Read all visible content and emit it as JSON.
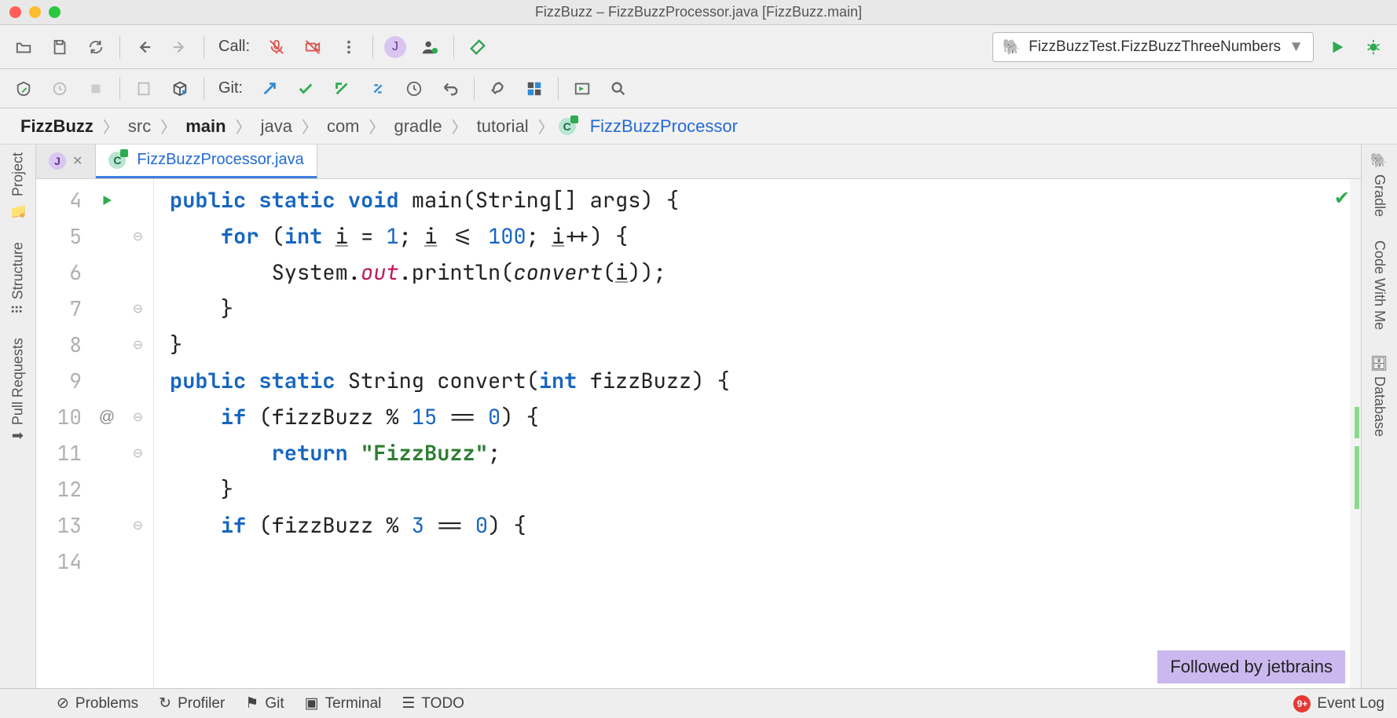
{
  "title": "FizzBuzz – FizzBuzzProcessor.java [FizzBuzz.main]",
  "toolbar": {
    "call_label": "Call:",
    "run_config": "FizzBuzzTest.FizzBuzzThreeNumbers",
    "git_label": "Git:"
  },
  "breadcrumbs": [
    "FizzBuzz",
    "src",
    "main",
    "java",
    "com",
    "gradle",
    "tutorial",
    "FizzBuzzProcessor"
  ],
  "tabs": [
    {
      "label": "J",
      "type": "j"
    },
    {
      "label": "FizzBuzzProcessor.java",
      "type": "class",
      "active": true
    }
  ],
  "left_panels": [
    "Project",
    "Structure",
    "Pull Requests"
  ],
  "right_panels": [
    "Gradle",
    "Code With Me",
    "Database"
  ],
  "line_start": 4,
  "code_lines": [
    {
      "n": 4,
      "raw": "public static void main(String[] args) {",
      "tokens": [
        [
          "kw",
          "public"
        ],
        [
          " "
        ],
        [
          "kw",
          "static"
        ],
        [
          " "
        ],
        [
          "kw",
          "void"
        ],
        [
          " "
        ],
        [
          "",
          "main(String[] args) {"
        ]
      ],
      "run": true,
      "fold": ""
    },
    {
      "n": 5,
      "raw": "    for (int i = 1; i <= 100; i++) {",
      "tokens": [
        [
          "",
          "    "
        ],
        [
          "kw",
          "for"
        ],
        [
          "",
          " ("
        ],
        [
          "kw",
          "int"
        ],
        [
          "",
          " "
        ],
        [
          "underline",
          "i"
        ],
        [
          "",
          " = "
        ],
        [
          "num",
          "1"
        ],
        [
          "",
          "; "
        ],
        [
          "underline",
          "i"
        ],
        [
          "",
          " <= "
        ],
        [
          "num",
          "100"
        ],
        [
          "",
          "; "
        ],
        [
          "underline",
          "i"
        ],
        [
          "",
          "++) {"
        ]
      ],
      "fold": "⊖"
    },
    {
      "n": 6,
      "raw": "        System.out.println(convert(i));",
      "tokens": [
        [
          "",
          "        System."
        ],
        [
          "static-field",
          "out"
        ],
        [
          "",
          ".println("
        ],
        [
          "call-italic",
          "convert"
        ],
        [
          "",
          "("
        ],
        [
          "underline",
          "i"
        ],
        [
          "",
          "));"
        ]
      ]
    },
    {
      "n": 7,
      "raw": "    }",
      "tokens": [
        [
          "",
          "    }"
        ]
      ],
      "fold": "⊖"
    },
    {
      "n": 8,
      "raw": "}",
      "tokens": [
        [
          "",
          "}"
        ]
      ],
      "fold": "⊖"
    },
    {
      "n": 9,
      "raw": "",
      "tokens": [
        [
          "",
          ""
        ]
      ]
    },
    {
      "n": 10,
      "raw": "public static String convert(int fizzBuzz) {",
      "tokens": [
        [
          "kw",
          "public"
        ],
        [
          " "
        ],
        [
          "kw",
          "static"
        ],
        [
          "",
          " String "
        ],
        [
          "",
          "convert("
        ],
        [
          "kw",
          "int"
        ],
        [
          "",
          " fizzBuzz) {"
        ]
      ],
      "fold": "⊖",
      "override": "@"
    },
    {
      "n": 11,
      "raw": "    if (fizzBuzz % 15 == 0) {",
      "tokens": [
        [
          "",
          "    "
        ],
        [
          "kw",
          "if"
        ],
        [
          "",
          " (fizzBuzz % "
        ],
        [
          "num",
          "15"
        ],
        [
          "",
          " == "
        ],
        [
          "num",
          "0"
        ],
        [
          "",
          ") {"
        ]
      ],
      "fold": "⊖"
    },
    {
      "n": 12,
      "raw": "        return \"FizzBuzz\";",
      "tokens": [
        [
          "",
          "        "
        ],
        [
          "kw",
          "return"
        ],
        [
          "",
          " "
        ],
        [
          "str",
          "\"FizzBuzz\""
        ],
        [
          "",
          ";"
        ]
      ]
    },
    {
      "n": 13,
      "raw": "    }",
      "tokens": [
        [
          "",
          "    }"
        ]
      ],
      "fold": "⊖"
    },
    {
      "n": 14,
      "raw": "    if (fizzBuzz % 3 == 0) {",
      "tokens": [
        [
          "",
          "    "
        ],
        [
          "kw",
          "if"
        ],
        [
          "",
          " (fizzBuzz % "
        ],
        [
          "num",
          "3"
        ],
        [
          "",
          " == "
        ],
        [
          "num",
          "0"
        ],
        [
          "",
          ") {"
        ]
      ]
    }
  ],
  "follow": "Followed by jetbrains",
  "status": {
    "problems": "Problems",
    "profiler": "Profiler",
    "git": "Git",
    "terminal": "Terminal",
    "todo": "TODO",
    "eventlog": "Event Log",
    "notif": "9+"
  }
}
